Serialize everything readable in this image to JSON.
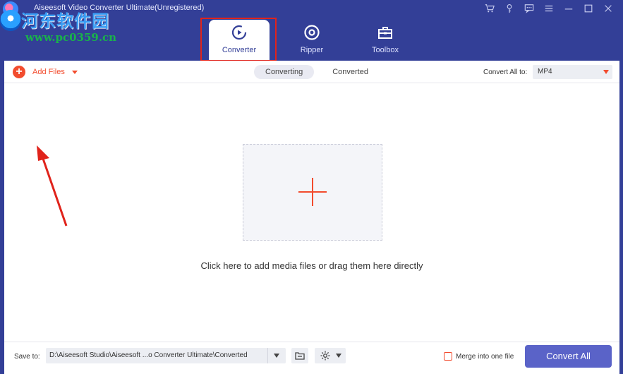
{
  "titlebar": {
    "title": "Aiseesoft Video Converter Ultimate(Unregistered)",
    "controls": [
      "cart-icon",
      "key-icon",
      "feedback-icon",
      "menu-icon",
      "minimize-icon",
      "maximize-icon",
      "close-icon"
    ]
  },
  "watermark": {
    "line1": "河东软件园",
    "line2": "www.pc0359.cn"
  },
  "nav": {
    "tabs": [
      {
        "label": "Converter",
        "icon": "converter-icon",
        "active": true
      },
      {
        "label": "Ripper",
        "icon": "disc-icon",
        "active": false
      },
      {
        "label": "Toolbox",
        "icon": "toolbox-icon",
        "active": false
      }
    ]
  },
  "toolbar": {
    "add_files_label": "Add Files",
    "subtabs": [
      {
        "label": "Converting",
        "active": true
      },
      {
        "label": "Converted",
        "active": false
      }
    ],
    "convert_all_label": "Convert All to:",
    "format_value": "MP4"
  },
  "dropzone": {
    "hint": "Click here to add media files or drag them here directly"
  },
  "bottombar": {
    "save_label": "Save to:",
    "save_path": "D:\\Aiseesoft Studio\\Aiseesoft ...o Converter Ultimate\\Converted",
    "merge_label": "Merge into one file",
    "merge_checked": false,
    "convert_button": "Convert All"
  },
  "colors": {
    "frame": "#333f97",
    "accent": "#f24c2e",
    "button": "#5a63c8",
    "annotation": "#e0231b"
  }
}
